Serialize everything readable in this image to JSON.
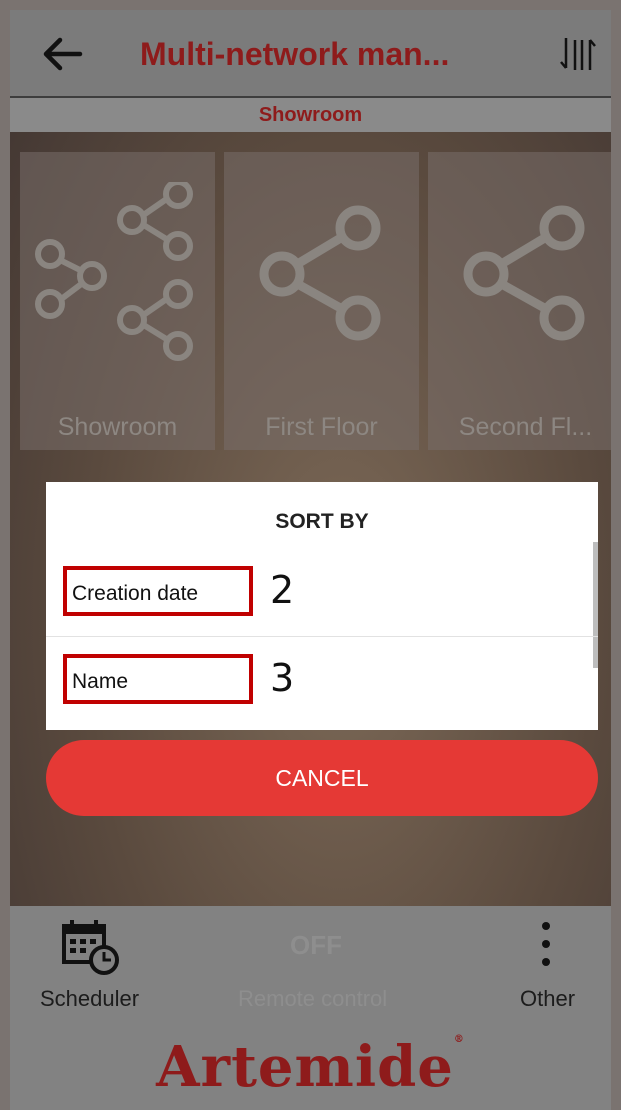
{
  "header": {
    "title": "Multi-network man...",
    "back_icon": "back-arrow-icon",
    "sort_icon": "sort-icon"
  },
  "subheader": {
    "label": "Showroom"
  },
  "tiles": [
    {
      "label": "Showroom",
      "icon": "multi-network-icon"
    },
    {
      "label": "First Floor",
      "icon": "share-network-icon"
    },
    {
      "label": "Second Fl...",
      "icon": "share-network-icon"
    }
  ],
  "dialog": {
    "title": "SORT BY",
    "options": [
      {
        "label": "Creation date",
        "annotation": "2"
      },
      {
        "label": "Name",
        "annotation": "3"
      }
    ]
  },
  "cancel_label": "CANCEL",
  "bottom": {
    "scheduler_label": "Scheduler",
    "off_label": "OFF",
    "remote_label": "Remote control",
    "other_label": "Other",
    "logo": "Artemide"
  },
  "colors": {
    "brand_red": "#8e1b1b",
    "cancel_red": "#e53935",
    "annotation_red": "#c00000"
  }
}
